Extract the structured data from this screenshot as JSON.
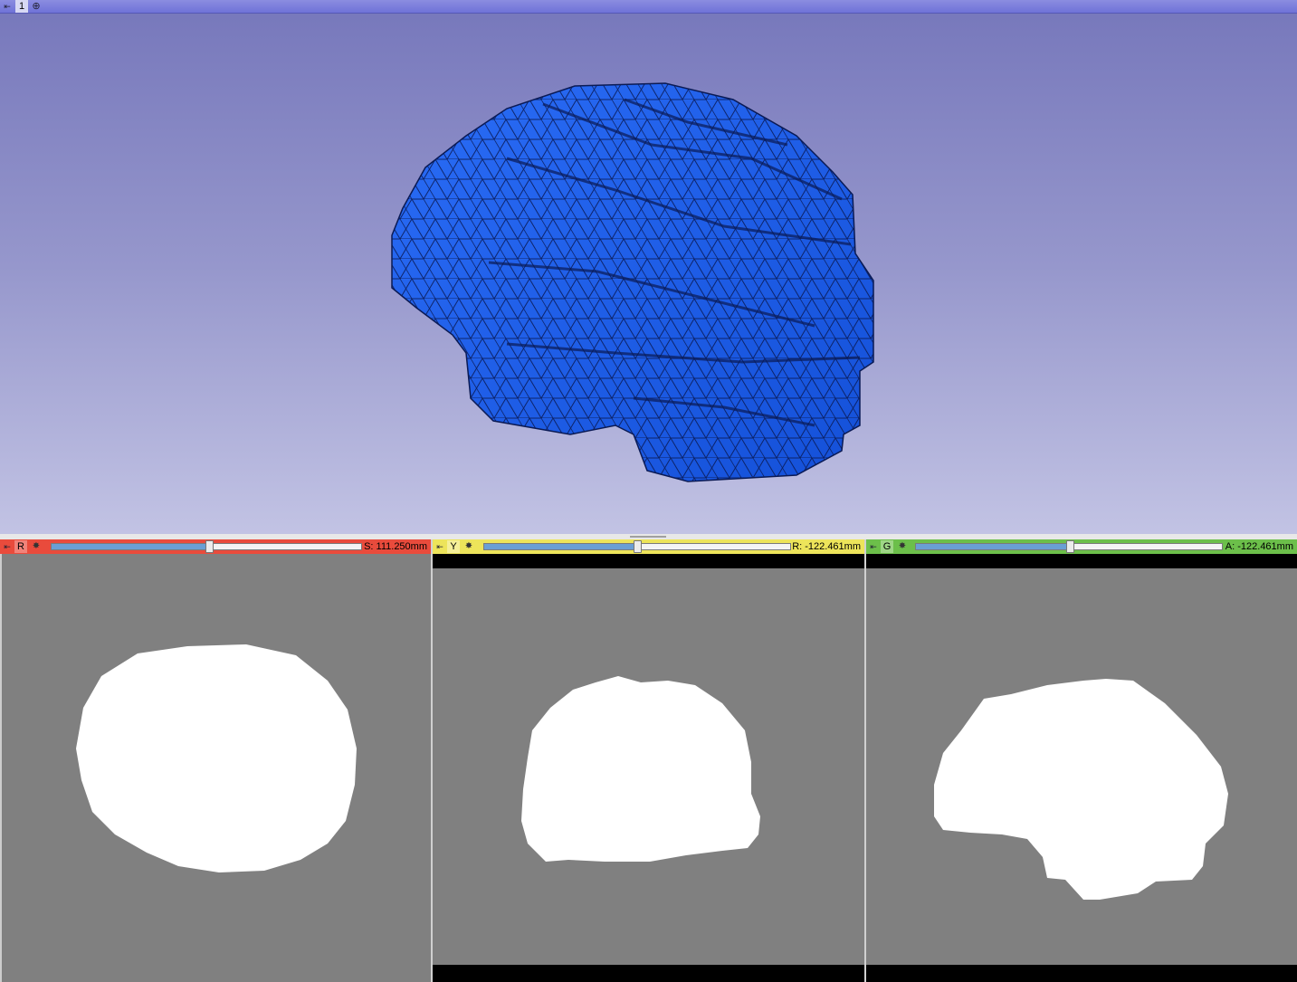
{
  "view3d": {
    "label": "1",
    "pin_icon": "pin-icon",
    "center_icon": "center-view-icon",
    "background_top": "#7677bb",
    "background_bottom": "#c2c3e4",
    "model_color": "#1f5ef0"
  },
  "slices": {
    "red": {
      "label": "R",
      "offset": "S: 111.250mm",
      "color": "#e94b3c",
      "slider_position": 0.51
    },
    "yellow": {
      "label": "Y",
      "offset": "R: -122.461mm",
      "color": "#ede45a",
      "slider_position": 0.5
    },
    "green": {
      "label": "G",
      "offset": "A: -122.461mm",
      "color": "#6cbf4a",
      "slider_position": 0.5
    }
  },
  "slice_colors": {
    "background": "#808080",
    "mask": "#ffffff"
  }
}
